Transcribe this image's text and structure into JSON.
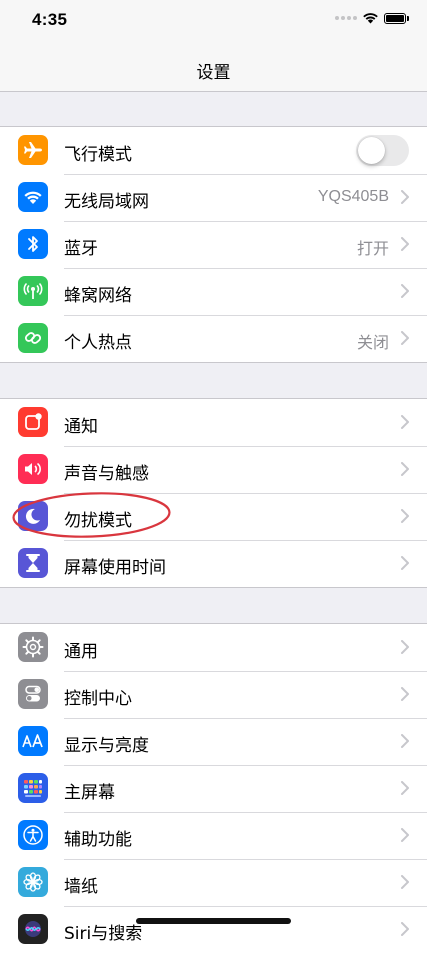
{
  "status_bar": {
    "time": "4:35"
  },
  "nav": {
    "title": "设置"
  },
  "groups": [
    {
      "items": [
        {
          "label": "飞行模式",
          "icon": "airplane-icon",
          "color": "#ff9500",
          "control": "toggle",
          "toggle_on": false
        },
        {
          "label": "无线局域网",
          "icon": "wifi-icon",
          "color": "#007aff",
          "value": "YQS405B"
        },
        {
          "label": "蓝牙",
          "icon": "bluetooth-icon",
          "color": "#007aff",
          "value": "打开"
        },
        {
          "label": "蜂窝网络",
          "icon": "cellular-antenna-icon",
          "color": "#34c759",
          "value": ""
        },
        {
          "label": "个人热点",
          "icon": "hotspot-link-icon",
          "color": "#34c759",
          "value": "关闭"
        }
      ]
    },
    {
      "items": [
        {
          "label": "通知",
          "icon": "notifications-icon",
          "color": "#ff3b30",
          "value": ""
        },
        {
          "label": "声音与触感",
          "icon": "speaker-icon",
          "color": "#ff2d55",
          "value": ""
        },
        {
          "label": "勿扰模式",
          "icon": "moon-icon",
          "color": "#5856d6",
          "value": "",
          "highlighted": true
        },
        {
          "label": "屏幕使用时间",
          "icon": "hourglass-icon",
          "color": "#5856d6",
          "value": ""
        }
      ]
    },
    {
      "items": [
        {
          "label": "通用",
          "icon": "gear-icon",
          "color": "#8e8e93",
          "value": ""
        },
        {
          "label": "控制中心",
          "icon": "toggles-icon",
          "color": "#8e8e93",
          "value": ""
        },
        {
          "label": "显示与亮度",
          "icon": "text-size-icon",
          "color": "#007aff",
          "value": ""
        },
        {
          "label": "主屏幕",
          "icon": "app-grid-icon",
          "color": "#2c5ee8",
          "value": ""
        },
        {
          "label": "辅助功能",
          "icon": "accessibility-icon",
          "color": "#007aff",
          "value": ""
        },
        {
          "label": "墙纸",
          "icon": "flower-icon",
          "color": "#34aadc",
          "value": ""
        },
        {
          "label": "Siri与搜索",
          "icon": "siri-icon",
          "color": "#222222",
          "value": ""
        }
      ]
    }
  ],
  "annotation": {
    "color": "#d9363e"
  }
}
